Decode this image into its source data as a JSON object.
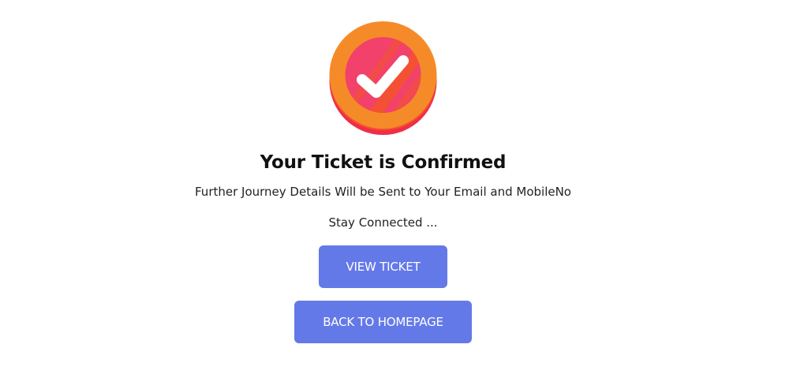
{
  "confirmation": {
    "icon": "check-badge-icon",
    "title": "Your Ticket is Confirmed",
    "message": "Further Journey Details Will be Sent to Your Email and MobileNo",
    "stay_connected": "Stay Connected ..."
  },
  "actions": {
    "view_ticket_label": "VIEW TICKET",
    "back_home_label": "BACK TO HOMEPAGE"
  },
  "colors": {
    "button_bg": "#6479e8",
    "badge_orange": "#f58b28",
    "badge_pink": "#f2416a",
    "badge_red": "#ef2e45"
  }
}
